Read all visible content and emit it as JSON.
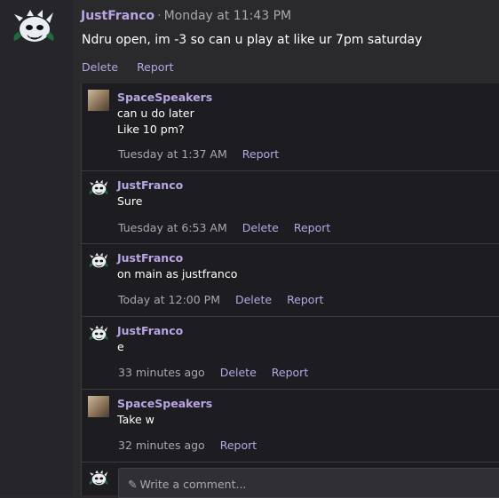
{
  "post": {
    "author": "JustFranco",
    "separator": "·",
    "time": "Monday at 11:43 PM",
    "text": "Ndru open, im -3 so can u play at like ur 7pm saturday",
    "actions": {
      "delete": "Delete",
      "report": "Report"
    }
  },
  "replies": [
    {
      "author": "SpaceSpeakers",
      "avatar": "photo-avatar",
      "lines": [
        "can u do later",
        "Like 10 pm?"
      ],
      "time": "Tuesday at 1:37 AM",
      "delete": "",
      "report": "Report"
    },
    {
      "author": "JustFranco",
      "avatar": "creature-avatar",
      "lines": [
        "Sure"
      ],
      "time": "Tuesday at 6:53 AM",
      "delete": "Delete",
      "report": "Report"
    },
    {
      "author": "JustFranco",
      "avatar": "creature-avatar",
      "lines": [
        "on main as justfranco"
      ],
      "time": "Today at 12:00 PM",
      "delete": "Delete",
      "report": "Report"
    },
    {
      "author": "JustFranco",
      "avatar": "creature-avatar",
      "lines": [
        "e"
      ],
      "time": "33 minutes ago",
      "delete": "Delete",
      "report": "Report"
    },
    {
      "author": "SpaceSpeakers",
      "avatar": "photo-avatar",
      "lines": [
        "Take w"
      ],
      "time": "32 minutes ago",
      "delete": "",
      "report": "Report"
    }
  ],
  "comment": {
    "placeholder": "Write a comment...",
    "icon": "pencil-icon"
  },
  "colors": {
    "accent": "#b7a6e3",
    "background": "#2a2a2d",
    "thread_bg": "#1d1d21"
  }
}
